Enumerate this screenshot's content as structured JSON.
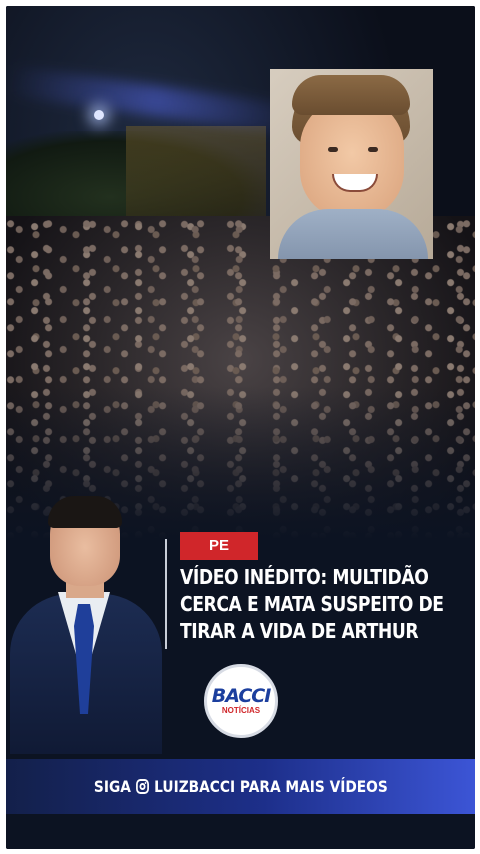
{
  "post": {
    "tag": "PE",
    "headline_lines": [
      "VÍDEO INÉDITO: MULTIDÃO",
      "CERCA E MATA SUSPEITO DE",
      "TIRAR A VIDA DE ARTHUR"
    ]
  },
  "logo": {
    "brand": "BACCI",
    "sub": "NOTÍCIAS"
  },
  "banner": {
    "prefix": "SIGA",
    "icon": "instagram-icon",
    "handle": "LUIZBACCI PARA MAIS VÍDEOS"
  },
  "colors": {
    "tag_red": "#d0262a",
    "banner_blue": "#1d2f8a",
    "background": "#0c1322"
  }
}
